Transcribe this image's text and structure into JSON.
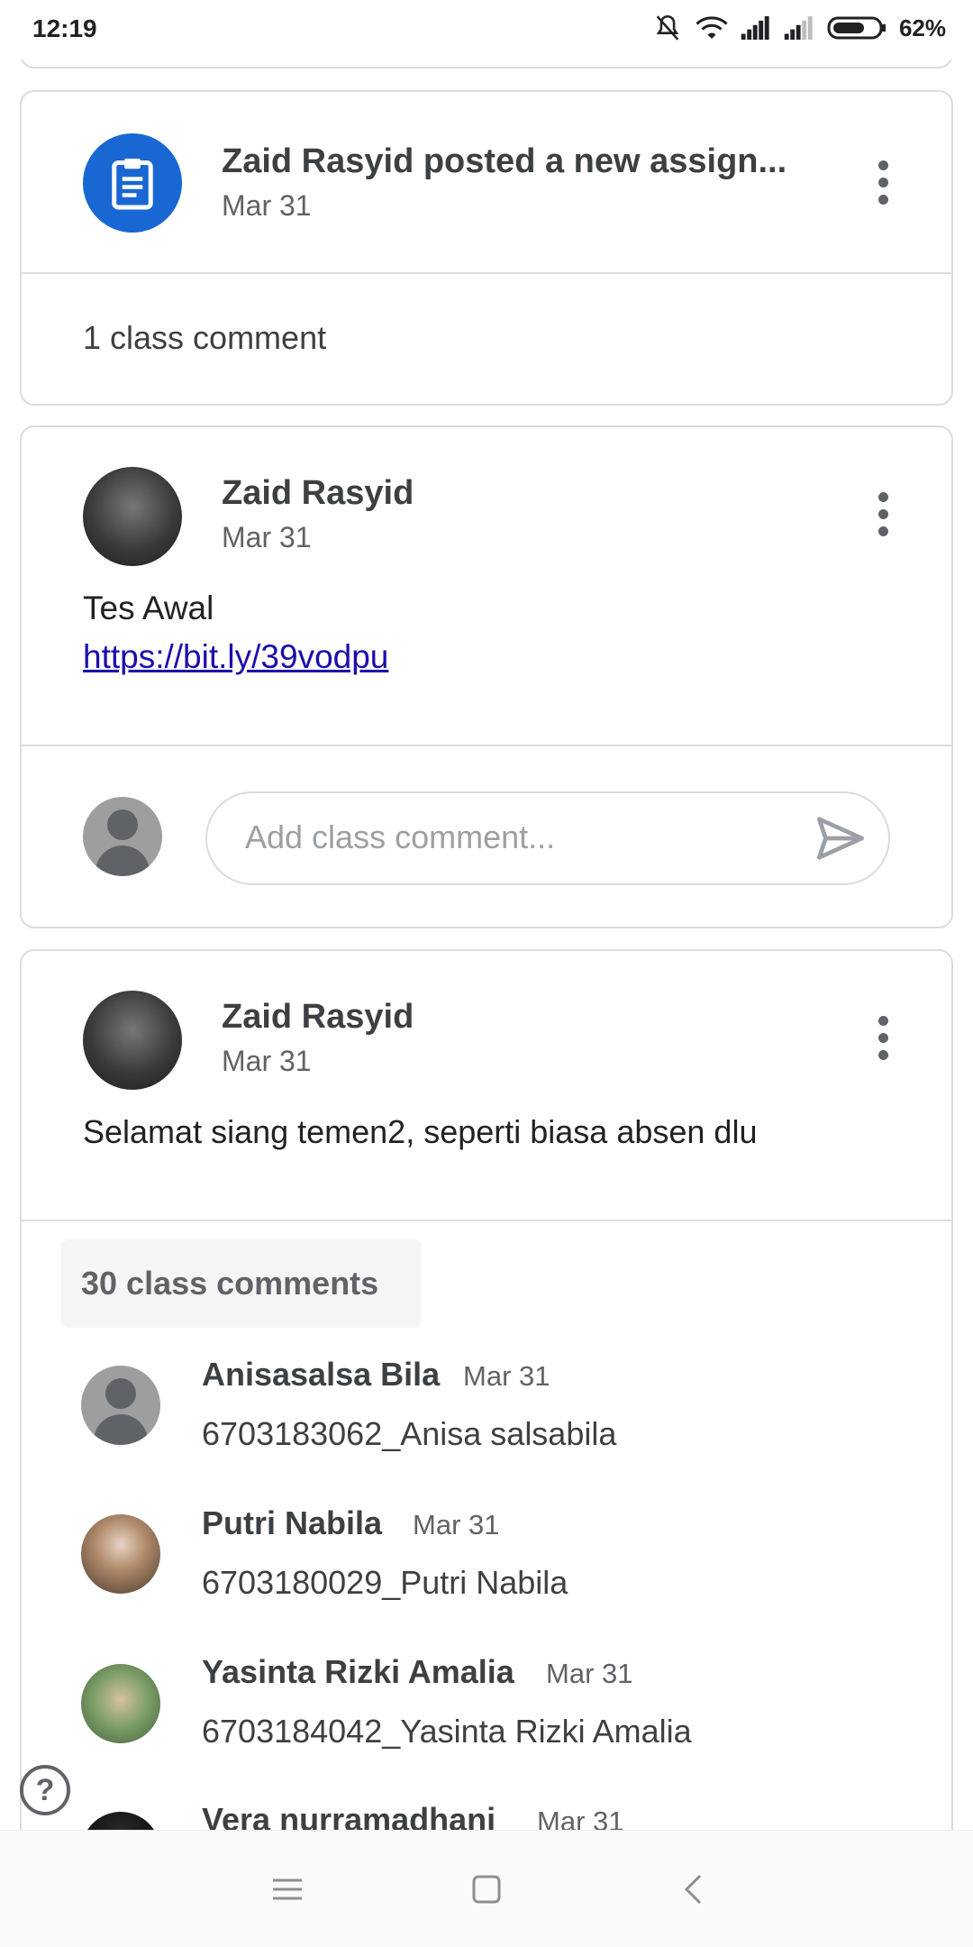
{
  "status_bar": {
    "time": "12:19",
    "battery": "62%"
  },
  "assignment_post": {
    "title": "Zaid Rasyid posted a new assign...",
    "date": "Mar 31",
    "comments": "1 class comment"
  },
  "post1": {
    "author": "Zaid Rasyid",
    "date": "Mar 31",
    "text": "Tes Awal",
    "link": "https://bit.ly/39vodpu",
    "comment_placeholder": "Add class comment..."
  },
  "post2": {
    "author": "Zaid Rasyid",
    "date": "Mar 31",
    "text": "Selamat siang temen2, seperti biasa absen dlu",
    "comments_count": "30 class comments",
    "comments": [
      {
        "name": "Anisasalsa Bila",
        "date": "Mar 31",
        "text": "6703183062_Anisa salsabila"
      },
      {
        "name": "Putri Nabila",
        "date": "Mar 31",
        "text": "6703180029_Putri Nabila"
      },
      {
        "name": "Yasinta Rizki Amalia",
        "date": "Mar 31",
        "text": "6703184042_Yasinta Rizki Amalia"
      },
      {
        "name": "Vera nurramadhani",
        "date": "Mar 31"
      }
    ]
  },
  "colors": {
    "accent": "#1967d2",
    "border": "#dadce0",
    "link": "#1a0dab"
  },
  "icons": {
    "assignment": "assignment-icon",
    "more": "more-vert-icon",
    "send": "send-icon",
    "help": "help-icon"
  }
}
